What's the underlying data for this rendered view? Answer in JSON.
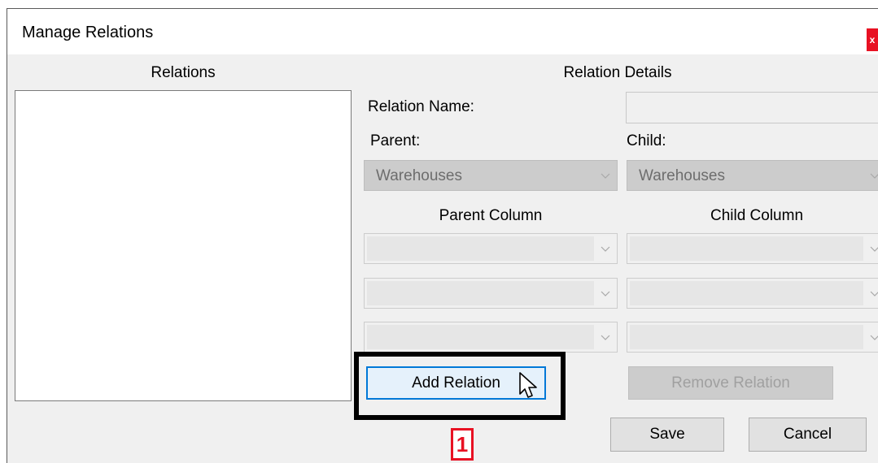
{
  "window": {
    "title": "Manage Relations",
    "close_label": "x"
  },
  "relations": {
    "header": "Relations",
    "items": []
  },
  "details": {
    "header": "Relation Details",
    "relation_name_label": "Relation Name:",
    "relation_name_value": "",
    "parent_label": "Parent:",
    "child_label": "Child:",
    "parent_table": "Warehouses",
    "child_table": "Warehouses",
    "parent_column_header": "Parent Column",
    "child_column_header": "Child Column",
    "parent_columns": [
      "",
      "",
      ""
    ],
    "child_columns": [
      "",
      "",
      ""
    ]
  },
  "buttons": {
    "add_relation": "Add Relation",
    "remove_relation": "Remove Relation",
    "save": "Save",
    "cancel": "Cancel"
  },
  "annotation": {
    "step_number": "1"
  },
  "colors": {
    "accent": "#0078d7",
    "close_red": "#e81123",
    "step_red": "#e81123",
    "dialog_bg": "#f0f0f0"
  }
}
